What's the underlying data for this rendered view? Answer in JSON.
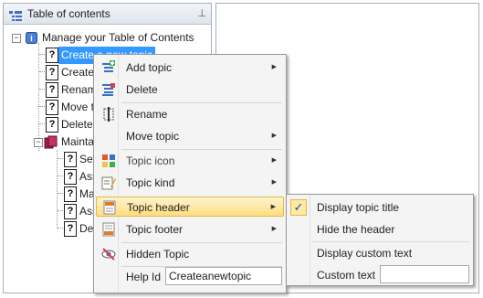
{
  "toc": {
    "title": "Table of contents",
    "pin_glyph": "⊥",
    "root": "Manage your Table of Contents",
    "items": [
      "Create a new topic",
      "Create a",
      "Rename",
      "Move to",
      "Delete t"
    ],
    "group": "Maintain",
    "subitems": [
      "Sele",
      "Assi",
      "Man",
      "Assi",
      "Defi"
    ]
  },
  "context_menu": {
    "add_topic": "Add topic",
    "delete": "Delete",
    "rename": "Rename",
    "move_topic": "Move topic",
    "topic_icon": "Topic icon",
    "topic_kind": "Topic kind",
    "topic_header": "Topic header",
    "topic_footer": "Topic footer",
    "hidden_topic": "Hidden Topic",
    "help_id_label": "Help Id",
    "help_id_value": "Createanewtopic"
  },
  "submenu": {
    "display_topic_title": "Display topic title",
    "hide_header": "Hide the header",
    "display_custom_text": "Display custom text",
    "custom_text_label": "Custom text",
    "custom_text_value": ""
  },
  "icons": {
    "arrow": "▶",
    "check": "✓",
    "question": "?"
  },
  "colors": {
    "selection": "#3399ff",
    "highlight": "#ffdd80"
  }
}
